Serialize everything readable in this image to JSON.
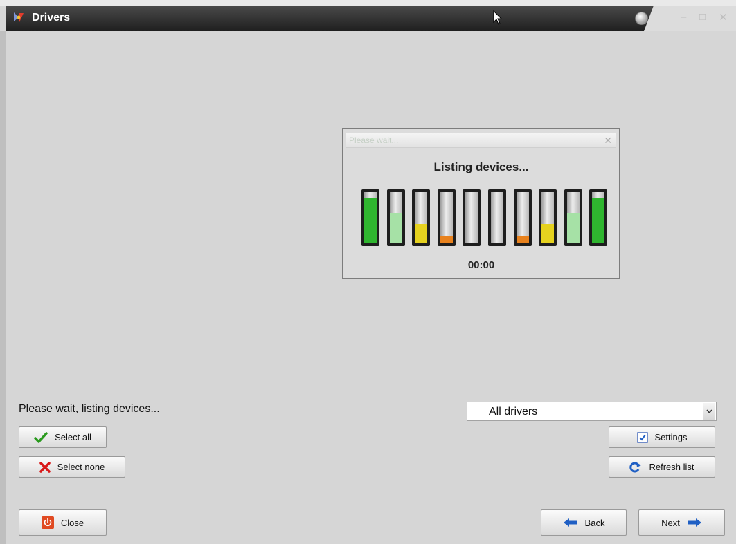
{
  "window": {
    "title": "Drivers",
    "minimize_glyph": "–",
    "maximize_glyph": "□",
    "close_glyph": "✕"
  },
  "dialog": {
    "title": "Please wait...",
    "close_glyph": "✕",
    "heading": "Listing devices...",
    "timer": "00:00",
    "meters": [
      {
        "level": 0.88,
        "color": "#2fb52f"
      },
      {
        "level": 0.6,
        "color": "#a6e1a6"
      },
      {
        "level": 0.38,
        "color": "#e6d21f"
      },
      {
        "level": 0.15,
        "color": "#e8821e"
      },
      {
        "level": 0.0,
        "color": "#bbbbbb"
      },
      {
        "level": 0.0,
        "color": "#bbbbbb"
      },
      {
        "level": 0.15,
        "color": "#e8821e"
      },
      {
        "level": 0.38,
        "color": "#e6d21f"
      },
      {
        "level": 0.6,
        "color": "#a6e1a6"
      },
      {
        "level": 0.88,
        "color": "#2fb52f"
      }
    ]
  },
  "status": {
    "text": "Please wait, listing devices..."
  },
  "filter": {
    "value": "All drivers"
  },
  "buttons": {
    "select_all": "Select all",
    "select_none": "Select none",
    "settings": "Settings",
    "refresh": "Refresh list",
    "close": "Close",
    "back": "Back",
    "next": "Next"
  },
  "colors": {
    "accent_blue": "#1f5fc4",
    "check_green": "#2a9a1e",
    "cross_red": "#d81818",
    "close_orange": "#e04a22"
  }
}
